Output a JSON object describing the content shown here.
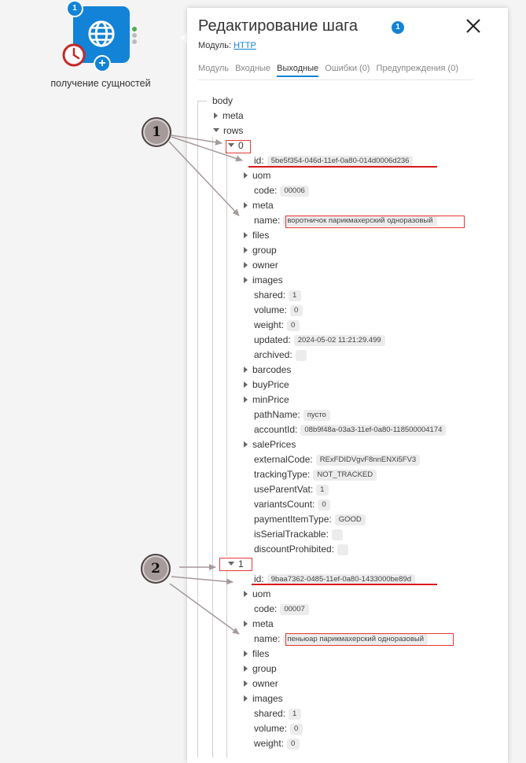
{
  "node": {
    "label": "получение сущностей",
    "badge": "1",
    "plus": "+"
  },
  "panel": {
    "title": "Редактирование шага",
    "title_badge": "1",
    "module_label": "Модуль:",
    "module_value": "HTTP",
    "tabs": [
      {
        "label": "Модуль"
      },
      {
        "label": "Входные"
      },
      {
        "label": "Выходные"
      },
      {
        "label": "Ошибки (0)"
      },
      {
        "label": "Предупреждения (0)"
      }
    ]
  },
  "tree": {
    "body": "body",
    "meta": "meta",
    "rows": "rows",
    "item0": {
      "index": "0",
      "fields": [
        {
          "key": "id:",
          "value": "5be5f354-046d-11ef-0a80-014d0006d236"
        },
        {
          "key": "uom"
        },
        {
          "key": "code:",
          "value": "00006"
        },
        {
          "key": "meta"
        },
        {
          "key": "name:",
          "value": "воротничок парикмахерский одноразовый"
        },
        {
          "key": "files"
        },
        {
          "key": "group"
        },
        {
          "key": "owner"
        },
        {
          "key": "images"
        },
        {
          "key": "shared:",
          "value": "1"
        },
        {
          "key": "volume:",
          "value": "0"
        },
        {
          "key": "weight:",
          "value": "0"
        },
        {
          "key": "updated:",
          "value": "2024-05-02 11:21:29.499"
        },
        {
          "key": "archived:",
          "value": ""
        },
        {
          "key": "barcodes"
        },
        {
          "key": "buyPrice"
        },
        {
          "key": "minPrice"
        },
        {
          "key": "pathName:",
          "value": "пусто"
        },
        {
          "key": "accountId:",
          "value": "08b9f48a-03a3-11ef-0a80-118500004174"
        },
        {
          "key": "salePrices"
        },
        {
          "key": "externalCode:",
          "value": "RExFDIDVgvF8nnENXi5FV3"
        },
        {
          "key": "trackingType:",
          "value": "NOT_TRACKED"
        },
        {
          "key": "useParentVat:",
          "value": "1"
        },
        {
          "key": "variantsCount:",
          "value": "0"
        },
        {
          "key": "paymentItemType:",
          "value": "GOOD"
        },
        {
          "key": "isSerialTrackable:",
          "value": ""
        },
        {
          "key": "discountProhibited:",
          "value": ""
        }
      ]
    },
    "item1": {
      "index": "1",
      "fields": [
        {
          "key": "id:",
          "value": "9baa7362-0485-11ef-0a80-1433000be89d"
        },
        {
          "key": "uom"
        },
        {
          "key": "code:",
          "value": "00007"
        },
        {
          "key": "meta"
        },
        {
          "key": "name:",
          "value": "пеньюар парикмахерский одноразовый"
        },
        {
          "key": "files"
        },
        {
          "key": "group"
        },
        {
          "key": "owner"
        },
        {
          "key": "images"
        },
        {
          "key": "shared:",
          "value": "1"
        },
        {
          "key": "volume:",
          "value": "0"
        },
        {
          "key": "weight:",
          "value": "0"
        }
      ]
    }
  },
  "callouts": [
    "1",
    "2"
  ],
  "colors": {
    "accent": "#1283d6",
    "annotation_red": "#e53935",
    "callout_fill": "#a69a9a",
    "clock_red": "#c62828"
  },
  "icons": {
    "module": "globe-icon",
    "schedule": "clock-icon",
    "close": "close-icon"
  }
}
